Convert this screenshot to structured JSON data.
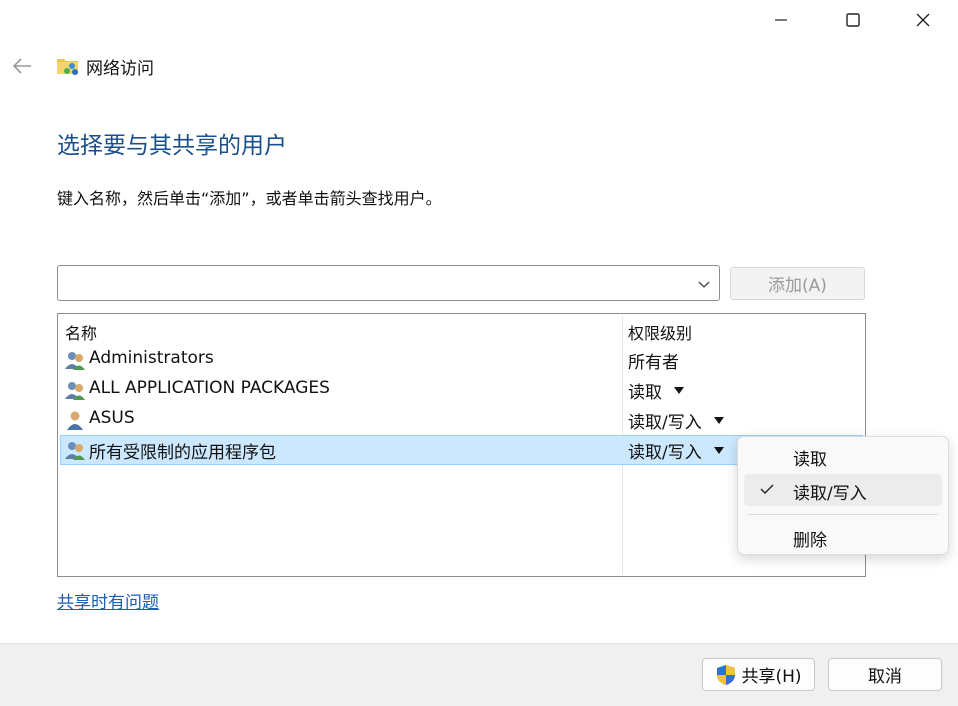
{
  "window": {
    "title": "网络访问"
  },
  "page": {
    "heading": "选择要与其共享的用户",
    "instruction": "键入名称，然后单击“添加”，或者单击箭头查找用户。"
  },
  "combo": {
    "value": ""
  },
  "add_button": {
    "label": "添加(A)"
  },
  "list": {
    "columns": [
      "名称",
      "权限级别"
    ],
    "rows": [
      {
        "name": "Administrators",
        "permission": "所有者",
        "icon": "user-group-icon",
        "has_dropdown": false
      },
      {
        "name": "ALL APPLICATION PACKAGES",
        "permission": "读取",
        "icon": "user-group-icon",
        "has_dropdown": true
      },
      {
        "name": "ASUS",
        "permission": "读取/写入",
        "icon": "user-icon",
        "has_dropdown": true
      },
      {
        "name": "所有受限制的应用程序包",
        "permission": "读取/写入",
        "icon": "user-group-icon",
        "has_dropdown": true
      }
    ]
  },
  "help_link": "共享时有问题",
  "footer": {
    "share_label": "共享(H)",
    "cancel_label": "取消"
  },
  "context_menu": {
    "items": [
      {
        "label": "读取",
        "checked": false
      },
      {
        "label": "读取/写入",
        "checked": true
      },
      {
        "label": "删除",
        "checked": false
      }
    ]
  },
  "colors": {
    "heading": "#1a4f8c",
    "link": "#1a5fb4",
    "selection": "#cce8ff"
  }
}
